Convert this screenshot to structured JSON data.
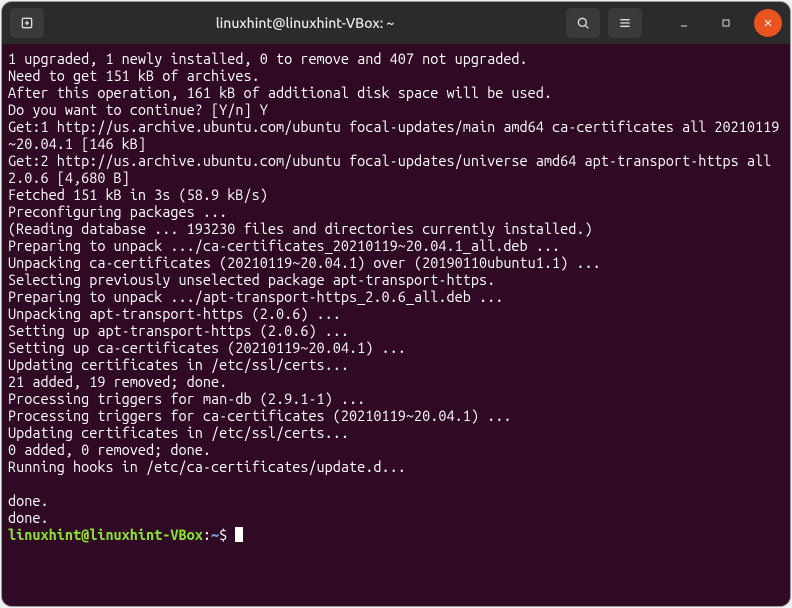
{
  "window": {
    "title": "linuxhint@linuxhint-VBox: ~"
  },
  "terminal": {
    "lines": [
      "1 upgraded, 1 newly installed, 0 to remove and 407 not upgraded.",
      "Need to get 151 kB of archives.",
      "After this operation, 161 kB of additional disk space will be used.",
      "Do you want to continue? [Y/n] Y",
      "Get:1 http://us.archive.ubuntu.com/ubuntu focal-updates/main amd64 ca-certificates all 20210119~20.04.1 [146 kB]",
      "Get:2 http://us.archive.ubuntu.com/ubuntu focal-updates/universe amd64 apt-transport-https all 2.0.6 [4,680 B]",
      "Fetched 151 kB in 3s (58.9 kB/s)",
      "Preconfiguring packages ...",
      "(Reading database ... 193230 files and directories currently installed.)",
      "Preparing to unpack .../ca-certificates_20210119~20.04.1_all.deb ...",
      "Unpacking ca-certificates (20210119~20.04.1) over (20190110ubuntu1.1) ...",
      "Selecting previously unselected package apt-transport-https.",
      "Preparing to unpack .../apt-transport-https_2.0.6_all.deb ...",
      "Unpacking apt-transport-https (2.0.6) ...",
      "Setting up apt-transport-https (2.0.6) ...",
      "Setting up ca-certificates (20210119~20.04.1) ...",
      "Updating certificates in /etc/ssl/certs...",
      "21 added, 19 removed; done.",
      "Processing triggers for man-db (2.9.1-1) ...",
      "Processing triggers for ca-certificates (20210119~20.04.1) ...",
      "Updating certificates in /etc/ssl/certs...",
      "0 added, 0 removed; done.",
      "Running hooks in /etc/ca-certificates/update.d...",
      "",
      "done.",
      "done."
    ],
    "prompt": {
      "user_host": "linuxhint@linuxhint-VBox",
      "sep1": ":",
      "path": "~",
      "sigil": "$"
    }
  }
}
